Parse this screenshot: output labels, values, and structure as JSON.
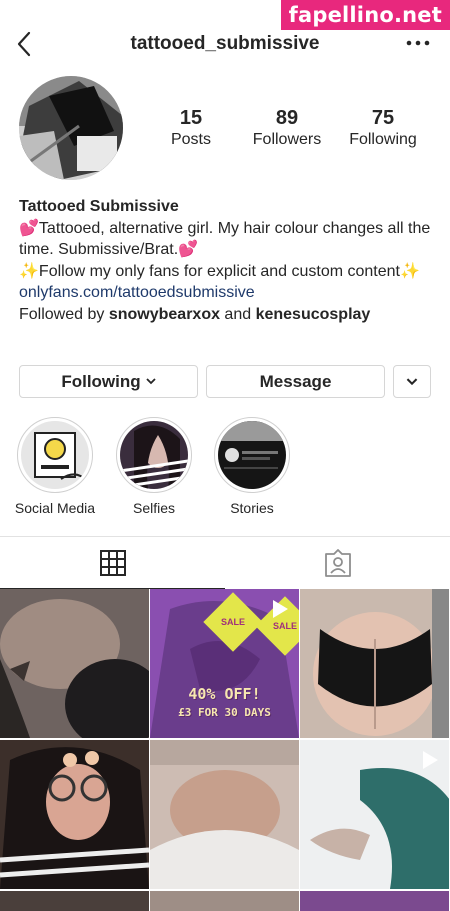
{
  "watermark": "fapellino.net",
  "header": {
    "title": "tattooed_submissive"
  },
  "stats": [
    {
      "value": "15",
      "label": "Posts"
    },
    {
      "value": "89",
      "label": "Followers"
    },
    {
      "value": "75",
      "label": "Following"
    }
  ],
  "bio": {
    "name": "Tattooed Submissive",
    "line1": "💕Tattooed, alternative girl. My hair colour changes all the time. Submissive/Brat.💕",
    "line2": "✨Follow my only fans for explicit and custom content✨",
    "link": "onlyfans.com/tattooedsubmissive",
    "followed_prefix": "Followed by ",
    "followed_user1": "snowybearxox",
    "followed_and": " and ",
    "followed_user2": "kenesucosplay"
  },
  "buttons": {
    "following": "Following",
    "message": "Message"
  },
  "highlights": [
    {
      "label": "Social Media"
    },
    {
      "label": "Selfies"
    },
    {
      "label": "Stories"
    }
  ],
  "promo": {
    "sale": "SALE",
    "line1": "40% OFF!",
    "line2": "£3 FOR 30 DAYS"
  },
  "colors": {
    "link": "#1f3a6b",
    "watermark_bg": "#e8287d",
    "text": "#262626"
  }
}
